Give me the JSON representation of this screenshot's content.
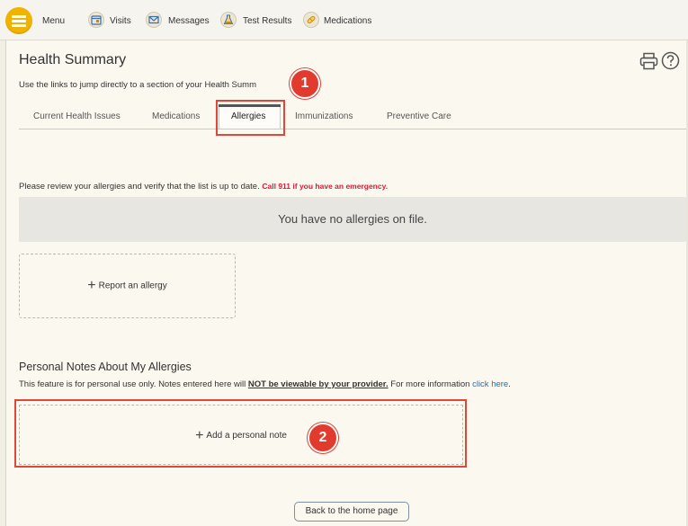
{
  "nav": {
    "menu_label": "Menu",
    "items": [
      {
        "label": "Visits",
        "icon": "calendar-icon"
      },
      {
        "label": "Messages",
        "icon": "envelope-icon"
      },
      {
        "label": "Test Results",
        "icon": "flask-icon"
      },
      {
        "label": "Medications",
        "icon": "pill-icon"
      }
    ]
  },
  "header": {
    "title": "Health Summary",
    "subtitle": "Use the links to jump directly to a section of your Health Summ"
  },
  "tabs": [
    {
      "label": "Current Health Issues",
      "active": false
    },
    {
      "label": "Medications",
      "active": false
    },
    {
      "label": "Allergies",
      "active": true
    },
    {
      "label": "Immunizations",
      "active": false
    },
    {
      "label": "Preventive Care",
      "active": false
    }
  ],
  "allergies": {
    "review_text": "Please review your allergies and verify that the list is up to date.",
    "emergency_text": "Call 911 if you have an emergency.",
    "empty_message": "You have no allergies on file.",
    "report_label": "Report an allergy"
  },
  "notes": {
    "heading": "Personal Notes About My Allergies",
    "desc_prefix": "This feature is for personal use only. Notes entered here will ",
    "desc_not_viewable": "NOT be viewable by your provider.",
    "desc_more": " For more information ",
    "desc_link": "click here",
    "desc_end": ".",
    "add_label": "Add a personal note"
  },
  "callouts": {
    "one": "1",
    "two": "2"
  },
  "back_label": "Back to the home page",
  "colors": {
    "accent": "#f0b400",
    "callout_red": "#e23b2e",
    "emergency_red": "#d0203a",
    "link_blue": "#2a6fb0"
  }
}
